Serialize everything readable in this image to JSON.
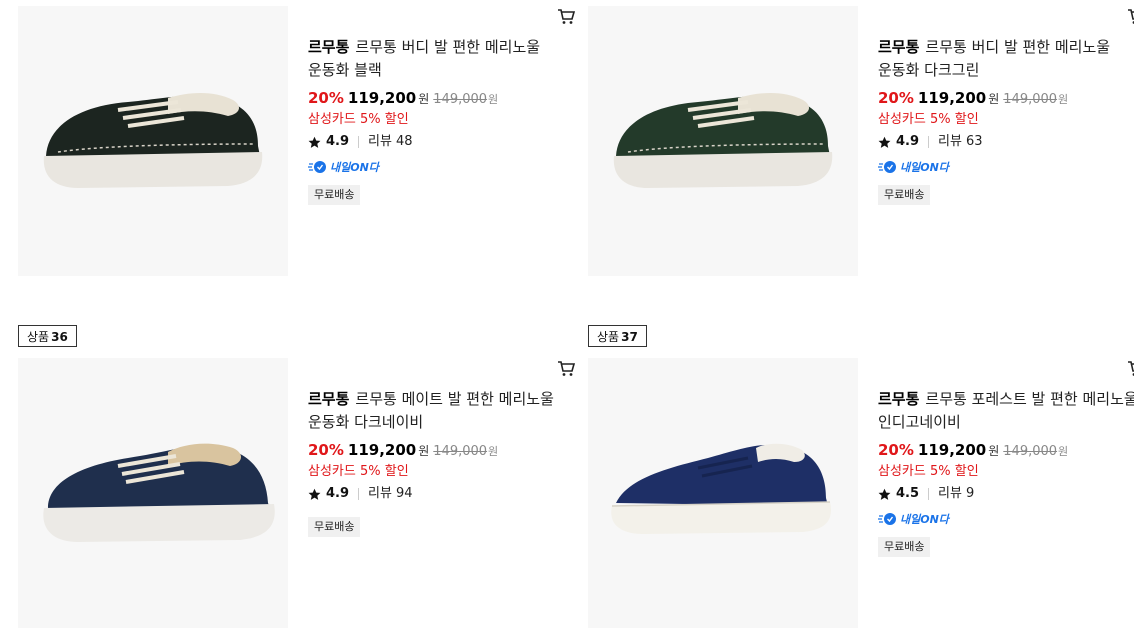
{
  "products": [
    {
      "badge_prefix": "",
      "badge_number": "",
      "brand": "르무통",
      "name": "르무통 버디 발 편한 메리노울 운동화 블랙",
      "discount": "20%",
      "price": "119,200",
      "currency": "원",
      "original_price": "149,000",
      "original_currency": "원",
      "card_discount": "삼성카드 5% 할인",
      "rating": "4.9",
      "review_label": "리뷰",
      "review_count": "48",
      "delivery_badge": "내일ON다",
      "free_shipping": "무료배송",
      "shoe_color": "#1c2520"
    },
    {
      "badge_prefix": "",
      "badge_number": "",
      "brand": "르무통",
      "name": "르무통 버디 발 편한 메리노울 운동화 다크그린",
      "discount": "20%",
      "price": "119,200",
      "currency": "원",
      "original_price": "149,000",
      "original_currency": "원",
      "card_discount": "삼성카드 5% 할인",
      "rating": "4.9",
      "review_label": "리뷰",
      "review_count": "63",
      "delivery_badge": "내일ON다",
      "free_shipping": "무료배송",
      "shoe_color": "#233a2a"
    },
    {
      "badge_prefix": "상품",
      "badge_number": "36",
      "brand": "르무통",
      "name": "르무통 메이트 발 편한 메리노울 운동화 다크네이비",
      "discount": "20%",
      "price": "119,200",
      "currency": "원",
      "original_price": "149,000",
      "original_currency": "원",
      "card_discount": "삼성카드 5% 할인",
      "rating": "4.9",
      "review_label": "리뷰",
      "review_count": "94",
      "delivery_badge": "",
      "free_shipping": "무료배송",
      "shoe_color": "#1f2f4d"
    },
    {
      "badge_prefix": "상품",
      "badge_number": "37",
      "brand": "르무통",
      "name": "르무통 포레스트 발 편한 메리노울 인디고네이비",
      "discount": "20%",
      "price": "119,200",
      "currency": "원",
      "original_price": "149,000",
      "original_currency": "원",
      "card_discount": "삼성카드 5% 할인",
      "rating": "4.5",
      "review_label": "리뷰",
      "review_count": "9",
      "delivery_badge": "내일ON다",
      "free_shipping": "무료배송",
      "shoe_color": "#1e2f66"
    }
  ],
  "colors": {
    "discount_red": "#e0171a",
    "delivery_blue": "#1a73e8",
    "thumb_bg": "#f7f7f7"
  }
}
